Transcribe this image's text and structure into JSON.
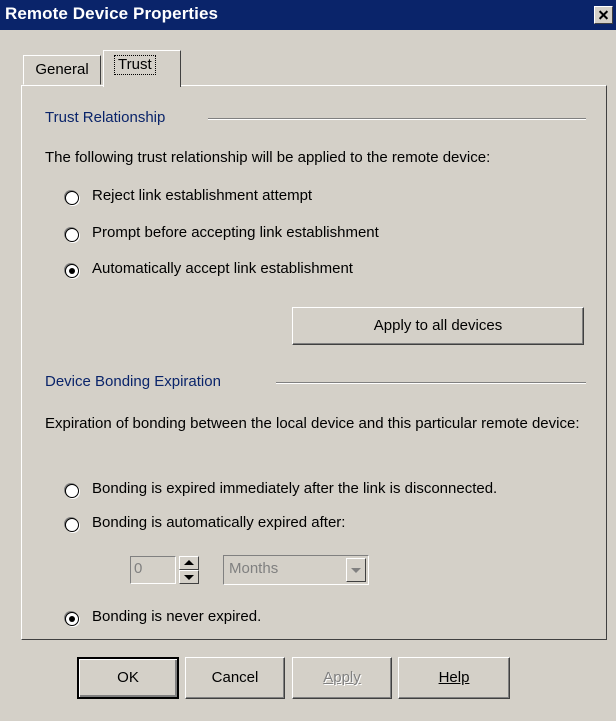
{
  "window": {
    "title": "Remote Device Properties"
  },
  "tabs": [
    {
      "label": "General"
    },
    {
      "label": "Trust"
    }
  ],
  "trust": {
    "group_title": "Trust Relationship",
    "description": "The following trust relationship will be applied to the remote device:",
    "options": [
      {
        "label": "Reject link establishment attempt",
        "selected": false
      },
      {
        "label": "Prompt before accepting link establishment",
        "selected": false
      },
      {
        "label": "Automatically accept link establishment",
        "selected": true
      }
    ],
    "apply_all_label": "Apply to all devices"
  },
  "bonding": {
    "group_title": "Device Bonding Expiration",
    "description": "Expiration of bonding between the local device and this particular remote device:",
    "options": [
      {
        "label": "Bonding is expired immediately after the link is disconnected.",
        "selected": false
      },
      {
        "label": "Bonding is automatically expired after:",
        "selected": false
      },
      {
        "label": "Bonding is never expired.",
        "selected": true
      }
    ],
    "expire_value": "0",
    "expire_unit": "Months"
  },
  "buttons": {
    "ok": "OK",
    "cancel": "Cancel",
    "apply": "Apply",
    "help": "Help"
  }
}
